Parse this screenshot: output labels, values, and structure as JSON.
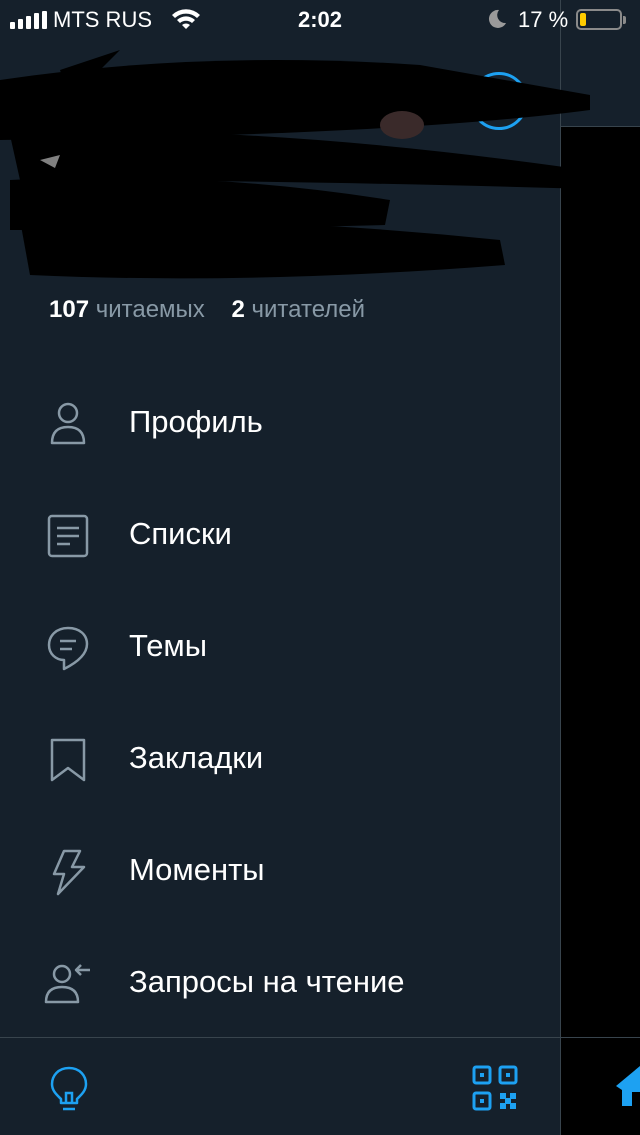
{
  "status_bar": {
    "carrier": "MTS RUS",
    "time": "2:02",
    "battery_percent": "17 %",
    "battery_level": 0.17
  },
  "profile": {
    "following_count": "107",
    "following_label": "читаемых",
    "followers_count": "2",
    "followers_label": "читателей"
  },
  "menu": {
    "items": [
      {
        "label": "Профиль",
        "icon": "profile-icon"
      },
      {
        "label": "Списки",
        "icon": "list-icon"
      },
      {
        "label": "Темы",
        "icon": "topics-icon"
      },
      {
        "label": "Закладки",
        "icon": "bookmark-icon"
      },
      {
        "label": "Моменты",
        "icon": "lightning-icon"
      },
      {
        "label": "Запросы на чтение",
        "icon": "follow-request-icon"
      }
    ]
  },
  "bottom_bar": {
    "left_icon": "lightbulb-icon",
    "right_icon": "qr-code-icon"
  },
  "colors": {
    "drawer_bg": "#15202b",
    "accent": "#1da1f2",
    "icon_gray": "#8899a6",
    "divider": "#38444d"
  }
}
